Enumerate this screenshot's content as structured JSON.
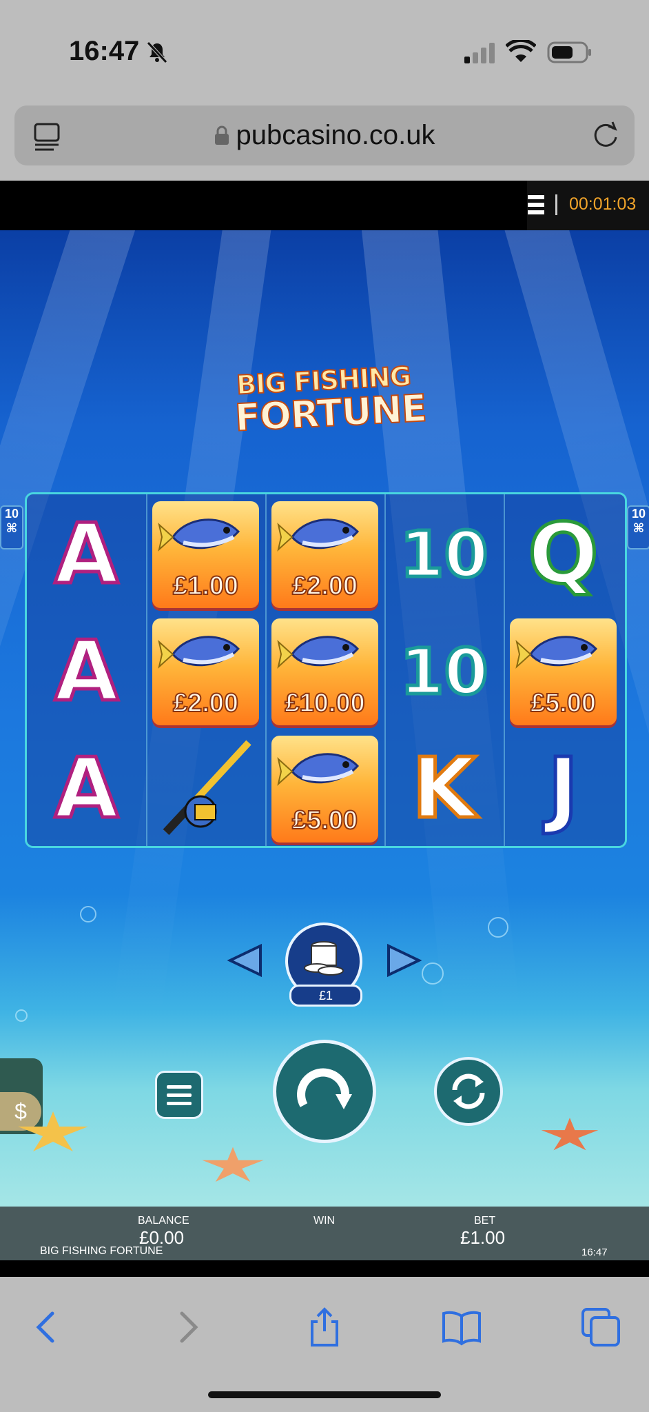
{
  "status_bar": {
    "time": "16:47"
  },
  "browser": {
    "url": "pubcasino.co.uk"
  },
  "game_header": {
    "session_timer": "00:01:03"
  },
  "game": {
    "title_line1": "BIG FISHING",
    "title_line2": "FORTUNE",
    "side_badge": "10",
    "reels": [
      [
        {
          "type": "letter",
          "text": "A"
        },
        {
          "type": "letter",
          "text": "A"
        },
        {
          "type": "letter",
          "text": "A"
        }
      ],
      [
        {
          "type": "prize",
          "text": "£1.00"
        },
        {
          "type": "prize",
          "text": "£2.00"
        },
        {
          "type": "rod",
          "text": ""
        }
      ],
      [
        {
          "type": "prize",
          "text": "£2.00"
        },
        {
          "type": "prize",
          "text": "£10.00"
        },
        {
          "type": "prize",
          "text": "£5.00"
        }
      ],
      [
        {
          "type": "letter",
          "text": "10"
        },
        {
          "type": "letter",
          "text": "10"
        },
        {
          "type": "letter",
          "text": "K"
        }
      ],
      [
        {
          "type": "letter",
          "text": "Q"
        },
        {
          "type": "prize",
          "text": "£5.00"
        },
        {
          "type": "letter",
          "text": "J"
        }
      ]
    ],
    "coin_value": "£1",
    "cashier_symbol": "$"
  },
  "info_bar": {
    "balance_label": "BALANCE",
    "balance_value": "£0.00",
    "win_label": "WIN",
    "bet_label": "BET",
    "bet_value": "£1.00",
    "game_name": "BIG FISHING FORTUNE",
    "clock": "16:47"
  },
  "colors": {
    "accent_timer": "#f0a32a",
    "reel_border": "#49d6e0",
    "prize_tile": "#ff9a2a"
  }
}
